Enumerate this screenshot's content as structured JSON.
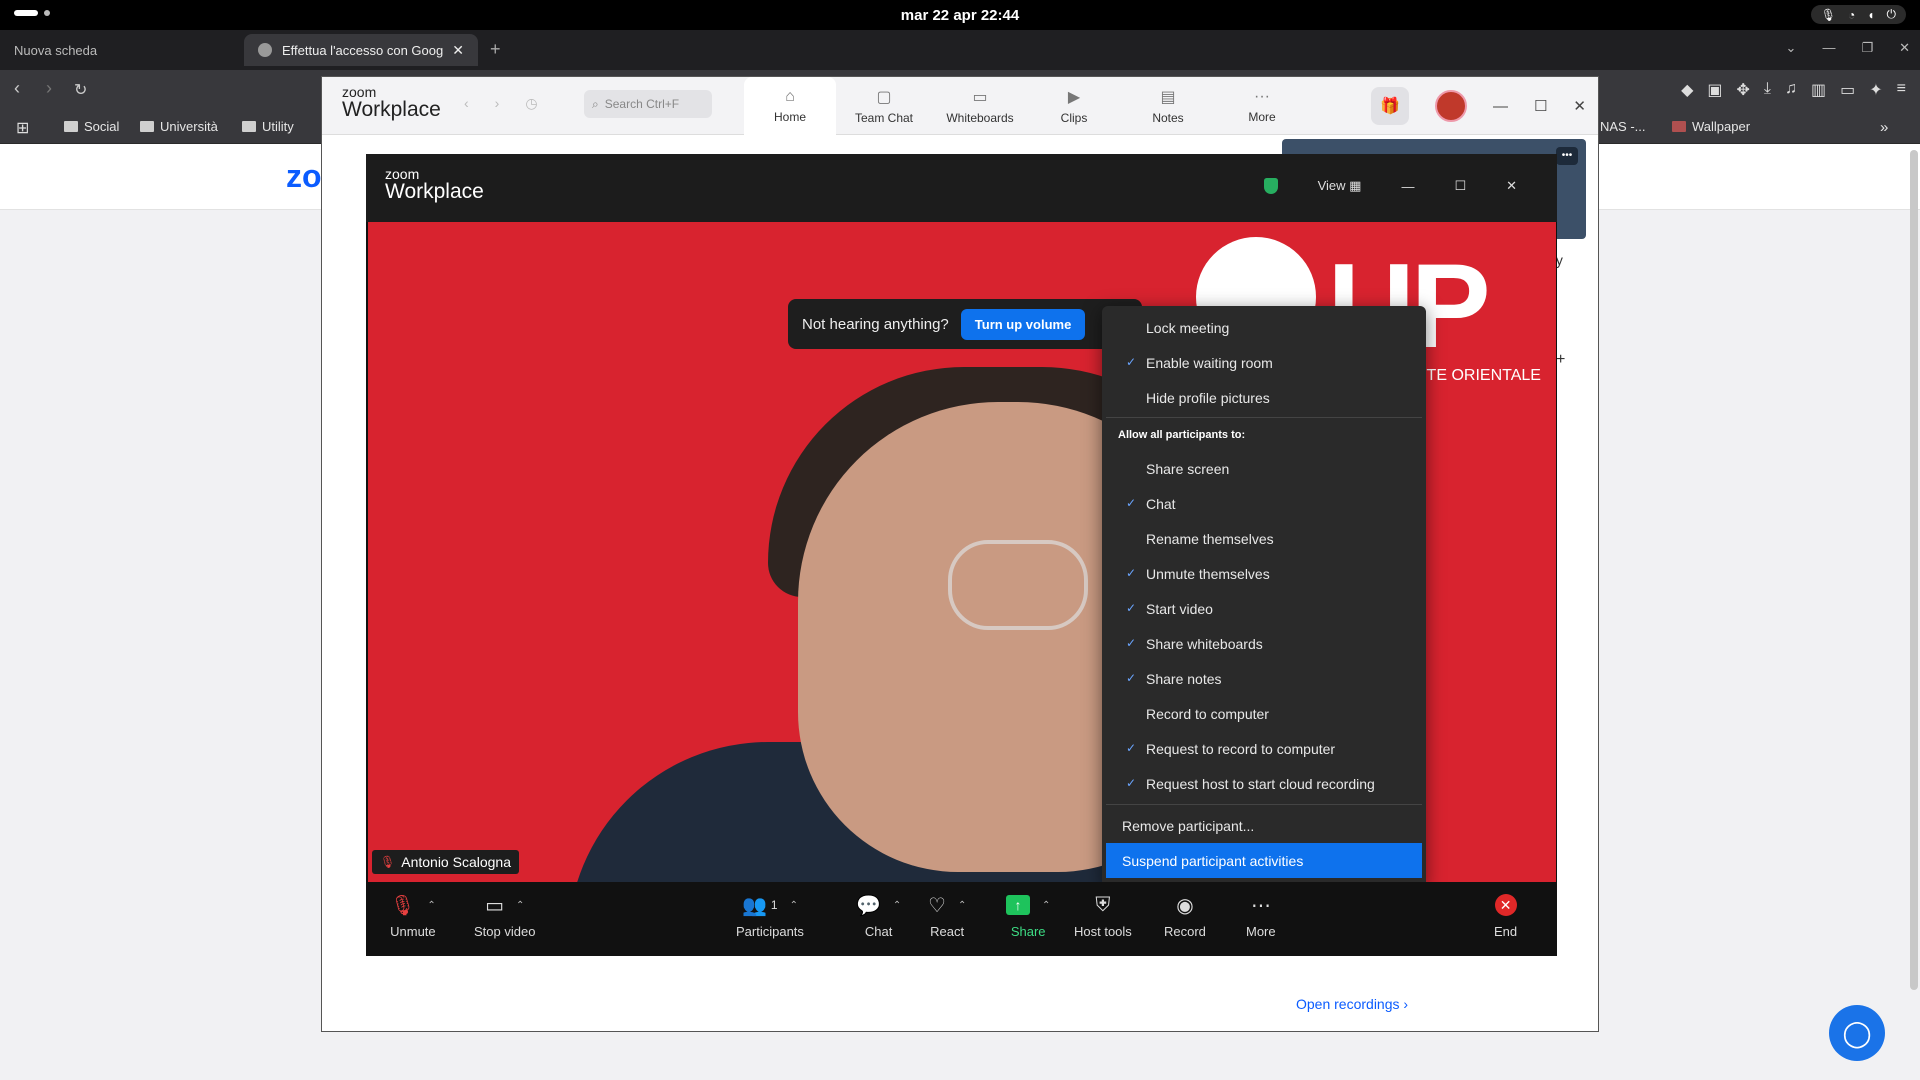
{
  "system": {
    "clock": "mar 22 apr  22:44"
  },
  "browser": {
    "tabs": [
      "Nuova scheda",
      "Effettua l'accesso con Goog"
    ],
    "bookmarks": [
      "Social",
      "Università",
      "Utility",
      "NAS -...",
      "Wallpaper"
    ]
  },
  "zoom_app": {
    "brand_small": "zoom",
    "brand_large": "Workplace",
    "search_placeholder": "Search Ctrl+F",
    "nav": [
      "Home",
      "Team Chat",
      "Whiteboards",
      "Clips",
      "Notes",
      "More"
    ],
    "side_text": "ty",
    "open_recordings": "Open recordings  ›"
  },
  "meeting": {
    "brand_small": "zoom",
    "brand_large": "Workplace",
    "view_label": "View",
    "toast_text": "Not hearing anything?",
    "toast_button": "Turn up volume",
    "background_logo": "UP",
    "background_caption": "UNIVERSITÀ DEL PIEMONTE ORIENTALE",
    "participant_name": "Antonio Scalogna",
    "menu": {
      "items_top": [
        {
          "label": "Lock meeting",
          "checked": false
        },
        {
          "label": "Enable waiting room",
          "checked": true
        },
        {
          "label": "Hide profile pictures",
          "checked": false
        }
      ],
      "header": "Allow all participants to:",
      "items_allow": [
        {
          "label": "Share screen",
          "checked": false
        },
        {
          "label": "Chat",
          "checked": true
        },
        {
          "label": "Rename themselves",
          "checked": false
        },
        {
          "label": "Unmute themselves",
          "checked": true
        },
        {
          "label": "Start video",
          "checked": true
        },
        {
          "label": "Share whiteboards",
          "checked": true
        },
        {
          "label": "Share notes",
          "checked": true
        },
        {
          "label": "Record to computer",
          "checked": false
        },
        {
          "label": "Request to record to computer",
          "checked": true
        },
        {
          "label": "Request host to start cloud recording",
          "checked": true
        }
      ],
      "remove": "Remove participant...",
      "suspend": "Suspend participant activities"
    },
    "controls": {
      "unmute": "Unmute",
      "stop_video": "Stop video",
      "participants": "Participants",
      "participants_count": "1",
      "chat": "Chat",
      "react": "React",
      "share": "Share",
      "host_tools": "Host tools",
      "record": "Record",
      "more": "More",
      "end": "End"
    }
  }
}
